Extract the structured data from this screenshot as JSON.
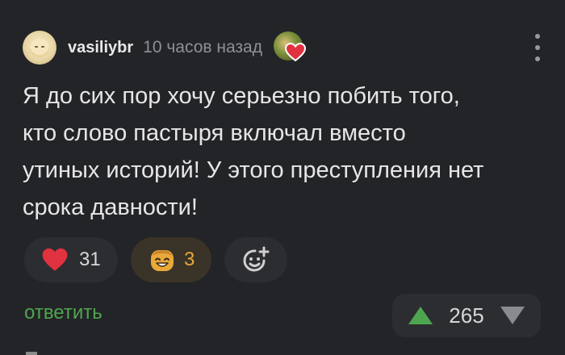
{
  "comment": {
    "username": "vasiliybr",
    "time": "10 часов назад",
    "text": "Я до сих пор хочу серьезно побить того,\nкто слово пастыря включал вместо\nутиных историй! У этого преступления нет\nсрока давности!"
  },
  "reactions": {
    "heart_count": "31",
    "smile_count": "3"
  },
  "actions": {
    "reply_label": "ответить"
  },
  "votes": {
    "score": "265"
  },
  "colors": {
    "background": "#232427",
    "accent_green": "#4fa54f",
    "upvote": "#4fa54f",
    "downvote": "#8a8b90",
    "heart": "#e0323f",
    "smile": "#e9a93a"
  },
  "icons": {
    "menu": "kebab-menu-icon",
    "heart": "heart-icon",
    "smile": "smiling-face-icon",
    "add_reaction": "add-emoji-icon",
    "upvote": "triangle-up-icon",
    "downvote": "triangle-down-icon"
  }
}
